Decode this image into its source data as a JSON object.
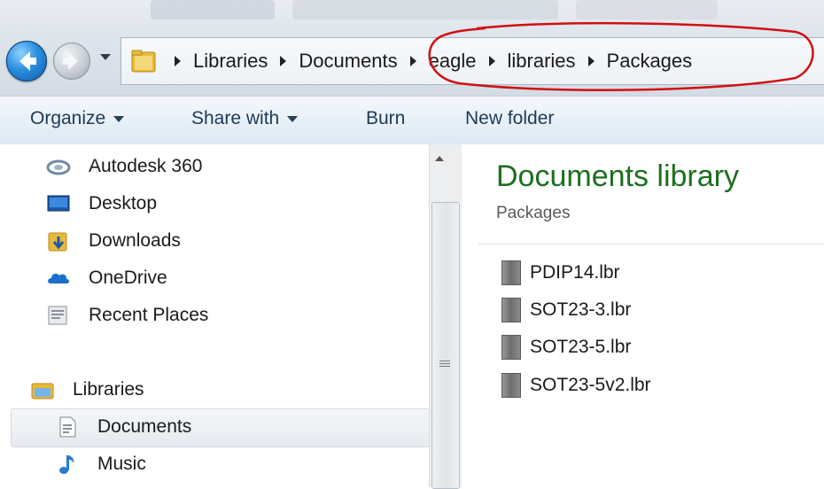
{
  "breadcrumbs": [
    "Libraries",
    "Documents",
    "eagle",
    "libraries",
    "Packages"
  ],
  "toolbar": {
    "organize": "Organize",
    "share_with": "Share with",
    "burn": "Burn",
    "new_folder": "New folder"
  },
  "navigation": {
    "favorites": [
      {
        "label": "Autodesk 360",
        "icon": "autodesk-360-icon"
      },
      {
        "label": "Desktop",
        "icon": "desktop-icon"
      },
      {
        "label": "Downloads",
        "icon": "downloads-folder-icon"
      },
      {
        "label": "OneDrive",
        "icon": "onedrive-icon"
      },
      {
        "label": "Recent Places",
        "icon": "recent-places-icon"
      }
    ],
    "libraries_label": "Libraries",
    "libraries": [
      {
        "label": "Documents",
        "icon": "documents-icon",
        "selected": true
      },
      {
        "label": "Music",
        "icon": "music-icon"
      }
    ]
  },
  "content": {
    "title": "Documents library",
    "subtitle": "Packages",
    "files": [
      "PDIP14.lbr",
      "SOT23-3.lbr",
      "SOT23-5.lbr",
      "SOT23-5v2.lbr"
    ]
  },
  "colors": {
    "library_title": "#1d6f1f",
    "annotation_circle": "#d01010",
    "command_text": "#1e3958"
  }
}
